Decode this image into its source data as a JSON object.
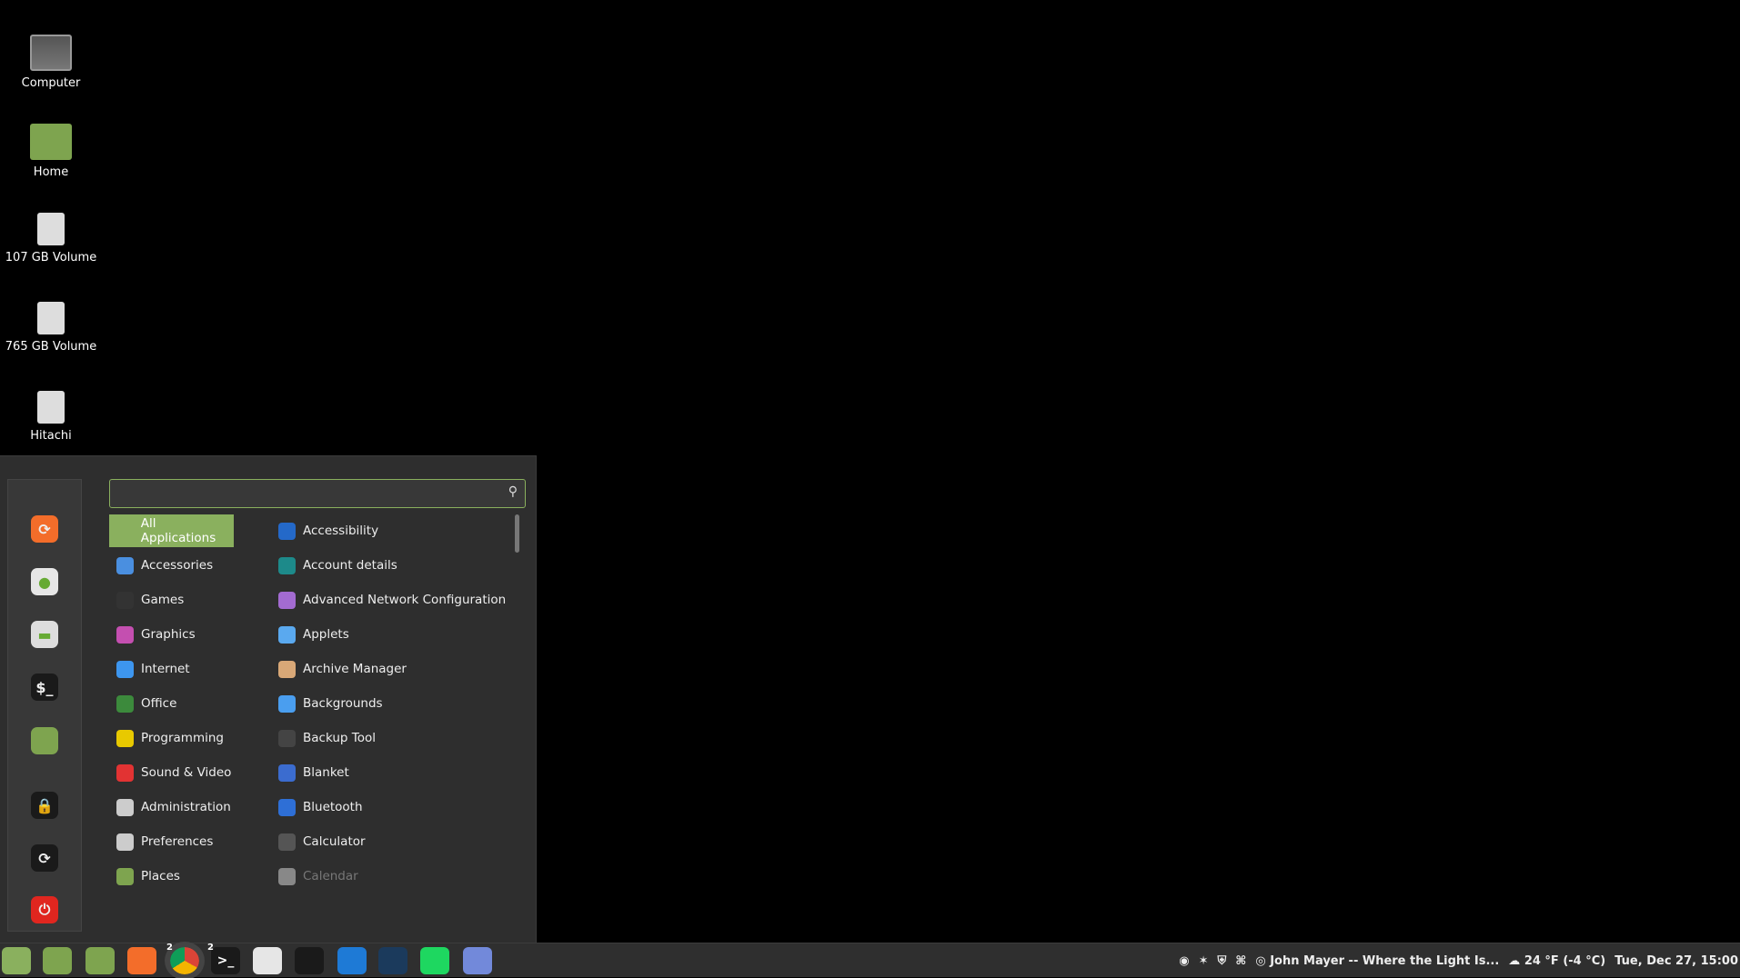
{
  "desktop": {
    "icons": [
      {
        "label": "Computer",
        "icon": "monitor-icon"
      },
      {
        "label": "Home",
        "icon": "home-folder-icon"
      },
      {
        "label": "107 GB Volume",
        "icon": "drive-icon"
      },
      {
        "label": "765 GB Volume",
        "icon": "drive-icon"
      },
      {
        "label": "Hitachi",
        "icon": "drive-icon"
      }
    ]
  },
  "menu": {
    "search": {
      "value": "",
      "placeholder": ""
    },
    "sidebar": [
      {
        "name": "firefox"
      },
      {
        "name": "software-manager"
      },
      {
        "name": "system-settings"
      },
      {
        "name": "terminal",
        "glyph": "$_"
      },
      {
        "name": "files"
      },
      {
        "name": "lock-screen"
      },
      {
        "name": "logout"
      },
      {
        "name": "shutdown"
      }
    ],
    "categories": [
      {
        "label": "All Applications",
        "selected": true
      },
      {
        "label": "Accessories"
      },
      {
        "label": "Games"
      },
      {
        "label": "Graphics"
      },
      {
        "label": "Internet"
      },
      {
        "label": "Office"
      },
      {
        "label": "Programming"
      },
      {
        "label": "Sound & Video"
      },
      {
        "label": "Administration"
      },
      {
        "label": "Preferences"
      },
      {
        "label": "Places"
      }
    ],
    "apps": [
      {
        "label": "Accessibility"
      },
      {
        "label": "Account details"
      },
      {
        "label": "Advanced Network Configuration"
      },
      {
        "label": "Applets"
      },
      {
        "label": "Archive Manager"
      },
      {
        "label": "Backgrounds"
      },
      {
        "label": "Backup Tool"
      },
      {
        "label": "Blanket"
      },
      {
        "label": "Bluetooth"
      },
      {
        "label": "Calculator"
      },
      {
        "label": "Calendar",
        "dimmed": true
      }
    ]
  },
  "taskbar": {
    "apps": [
      {
        "name": "menu",
        "color": "#8ab05e"
      },
      {
        "name": "show-desktop",
        "color": "#7ea44f"
      },
      {
        "name": "files",
        "color": "#7ea44f"
      },
      {
        "name": "firefox",
        "color": "#f36d2a"
      },
      {
        "name": "chrome",
        "badge": "2",
        "active": true
      },
      {
        "name": "terminal",
        "badge": "2",
        "glyph": ">_"
      },
      {
        "name": "software-manager",
        "color": "#e6e6e6"
      },
      {
        "name": "calculator"
      },
      {
        "name": "vscode",
        "color": "#1e7ad6"
      },
      {
        "name": "steam",
        "color": "#1b3a5c"
      },
      {
        "name": "spotify",
        "color": "#1ed760"
      },
      {
        "name": "discord",
        "color": "#7289da"
      }
    ],
    "tray": {
      "now_playing": "John Mayer -- Where the Light Is...",
      "weather": "24 °F (-4 °C)",
      "datetime": "Tue, Dec 27, 15:00"
    }
  }
}
